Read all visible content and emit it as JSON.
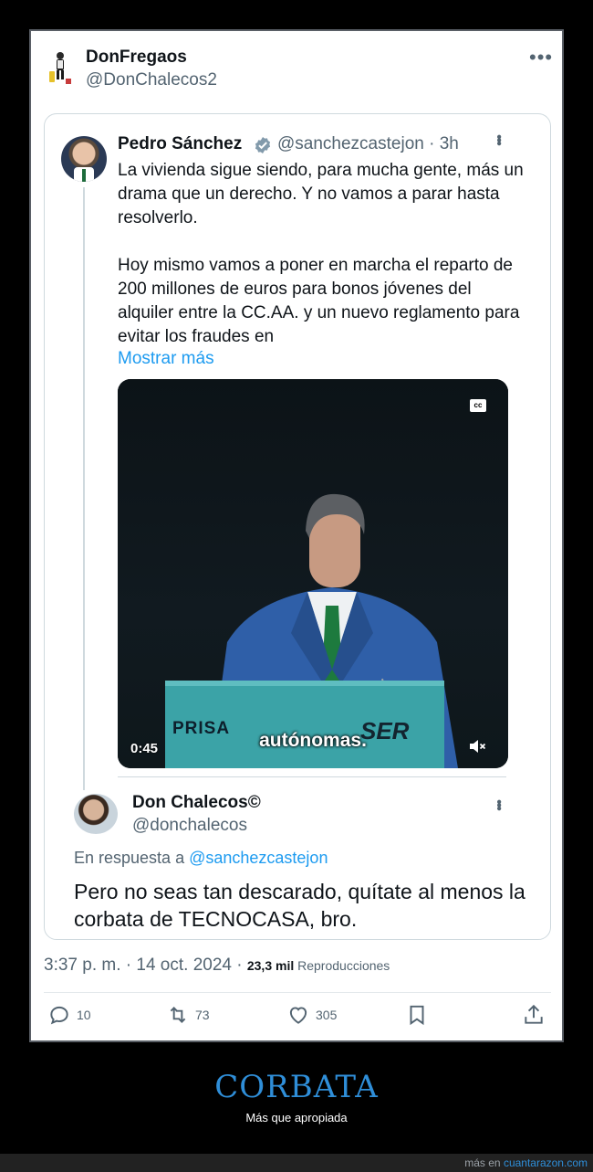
{
  "post": {
    "author_name": "DonFregaos",
    "author_handle": "@DonChalecos2",
    "more": "•••"
  },
  "quoted": {
    "author_name": "Pedro Sánchez",
    "author_handle": "@sanchezcastejon · 3h",
    "paragraph1": "La vivienda sigue siendo, para mucha gente, más un drama que un derecho. Y no vamos a parar hasta resolverlo.",
    "paragraph2": "Hoy mismo vamos a poner en marcha el reparto de 200 millones de euros para bonos jóvenes del alquiler entre la CC.AA. y un nuevo reglamento para evitar los fraudes en",
    "show_more": "Mostrar más",
    "video": {
      "cc_label": "cc",
      "subtitle": "autónomas.",
      "duration": "0:45",
      "podium_left": "PRISA",
      "podium_right": "SER",
      "tie_color": "#1d7a3e",
      "suit_color": "#2f5fa8"
    }
  },
  "reply": {
    "author_name": "Don Chalecos©",
    "author_handle": "@donchalecos",
    "reply_prefix": "En respuesta a ",
    "reply_target": "@sanchezcastejon",
    "text": "Pero no seas tan descarado, quítate al menos la corbata de TECNOCASA, bro."
  },
  "meta": {
    "time_date": "3:37 p. m. · 14 oct. 2024",
    "sep": " · ",
    "views_count": "23,3 mil",
    "views_label": " Reproducciones"
  },
  "actions": {
    "replies": "10",
    "reposts": "73",
    "likes": "305"
  },
  "caption": {
    "title": "CORBATA",
    "subtitle": "Más que apropiada"
  },
  "footer": {
    "prefix": "más en ",
    "site": "cuantarazon.com"
  },
  "colors": {
    "link": "#1d9bf0",
    "caption_title": "#2f8ed8",
    "secondary_text": "#536471"
  }
}
